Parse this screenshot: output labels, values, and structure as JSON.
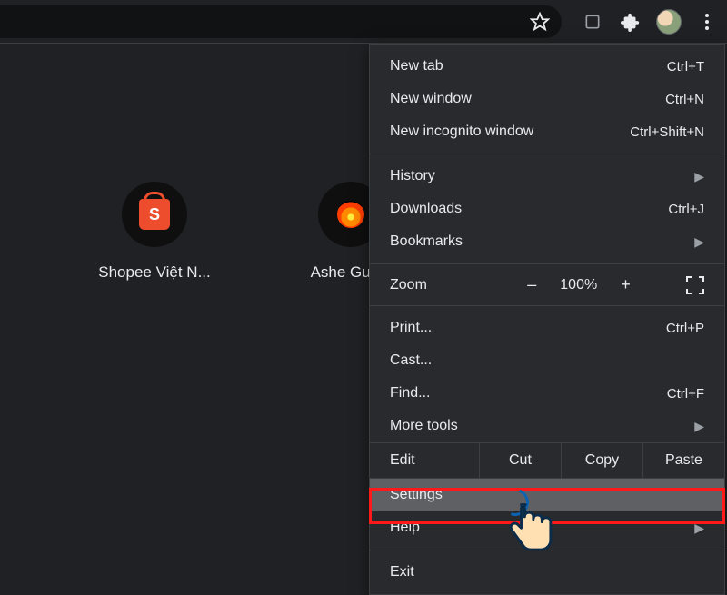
{
  "toolbar": {
    "star_title": "Bookmark this tab",
    "reader_title": "Reader mode",
    "extensions_title": "Extensions",
    "profile_title": "Profile",
    "menu_title": "Customize and control"
  },
  "shortcuts": [
    {
      "label": "Shopee Việt N...",
      "icon": "shopee"
    },
    {
      "label": "Ashe Guide",
      "icon": "flame"
    }
  ],
  "menu": {
    "new_tab": {
      "label": "New tab",
      "shortcut": "Ctrl+T"
    },
    "new_window": {
      "label": "New window",
      "shortcut": "Ctrl+N"
    },
    "new_incognito": {
      "label": "New incognito window",
      "shortcut": "Ctrl+Shift+N"
    },
    "history": {
      "label": "History"
    },
    "downloads": {
      "label": "Downloads",
      "shortcut": "Ctrl+J"
    },
    "bookmarks": {
      "label": "Bookmarks"
    },
    "zoom": {
      "label": "Zoom",
      "minus": "–",
      "pct": "100%",
      "plus": "+"
    },
    "print": {
      "label": "Print...",
      "shortcut": "Ctrl+P"
    },
    "cast": {
      "label": "Cast..."
    },
    "find": {
      "label": "Find...",
      "shortcut": "Ctrl+F"
    },
    "more_tools": {
      "label": "More tools"
    },
    "edit": {
      "label": "Edit",
      "cut": "Cut",
      "copy": "Copy",
      "paste": "Paste"
    },
    "settings": {
      "label": "Settings"
    },
    "help": {
      "label": "Help"
    },
    "exit": {
      "label": "Exit"
    }
  }
}
